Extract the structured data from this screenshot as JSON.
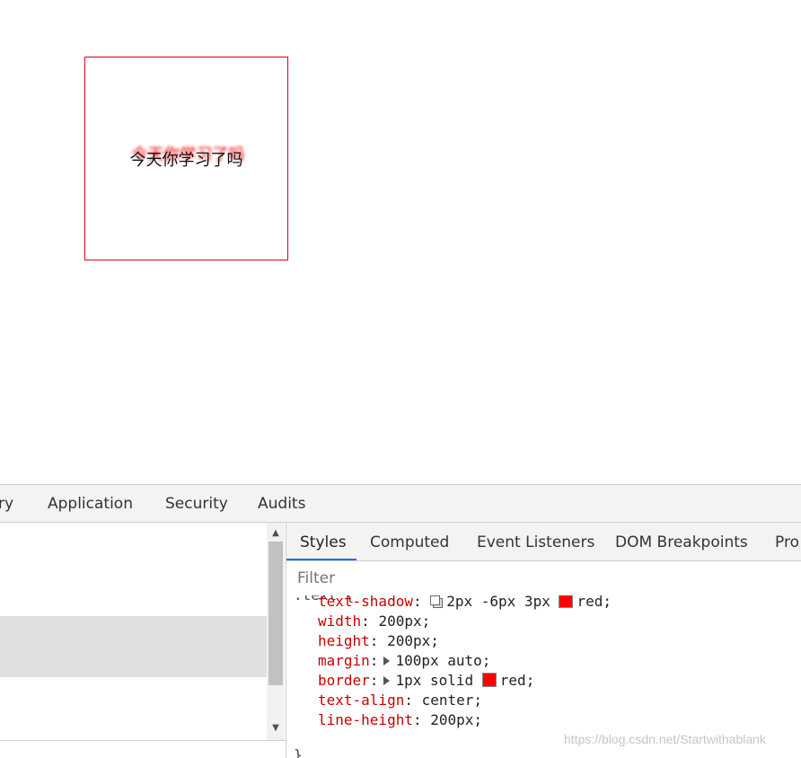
{
  "demo": {
    "text": "今天你学习了吗",
    "border_color": "#e0001a",
    "shadow_color": "#ff0000"
  },
  "devtools": {
    "main_tabs": [
      "ry",
      "Application",
      "Security",
      "Audits"
    ],
    "sub_tabs": [
      "Styles",
      "Computed",
      "Event Listeners",
      "DOM Breakpoints",
      "Pro"
    ],
    "active_sub_tab": "Styles",
    "filter_placeholder": "Filter",
    "rule_partial_top": ".text {",
    "rule_partial_bottom": "}",
    "rules": [
      {
        "prop": "text-shadow",
        "value": "2px -6px 3px",
        "color_value": "red"
      },
      {
        "prop": "width",
        "value": "200px;"
      },
      {
        "prop": "height",
        "value": "200px;"
      },
      {
        "prop": "margin",
        "value": "100px auto;"
      },
      {
        "prop": "border",
        "value": "1px solid",
        "color_value": "red"
      },
      {
        "prop": "text-align",
        "value": "center;"
      },
      {
        "prop": "line-height",
        "value": "200px;"
      }
    ],
    "accent_color": "#1a73e8"
  },
  "watermark": "https://blog.csdn.net/Startwithablank"
}
